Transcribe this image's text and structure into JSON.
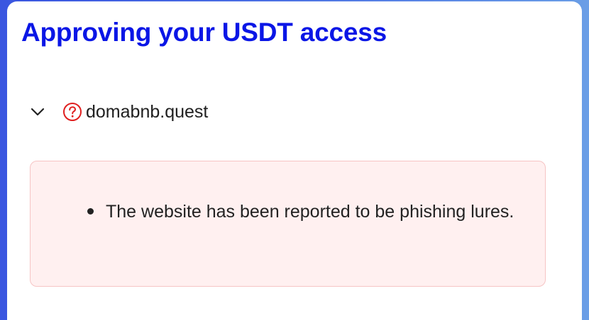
{
  "dialog": {
    "title": "Approving your USDT access"
  },
  "site": {
    "domain": "domabnb.quest",
    "status_icon": "question-circle-icon",
    "status_color": "#e01f1f",
    "expand_icon": "chevron-down-icon"
  },
  "alert": {
    "background": "#fff0f0",
    "border": "#f6c4c4",
    "items": [
      {
        "text": "The website has been reported to be phishing lures."
      }
    ]
  },
  "colors": {
    "title": "#0a16e6",
    "frame_gradient": [
      "#3a56e0",
      "#6a9ee6"
    ]
  }
}
